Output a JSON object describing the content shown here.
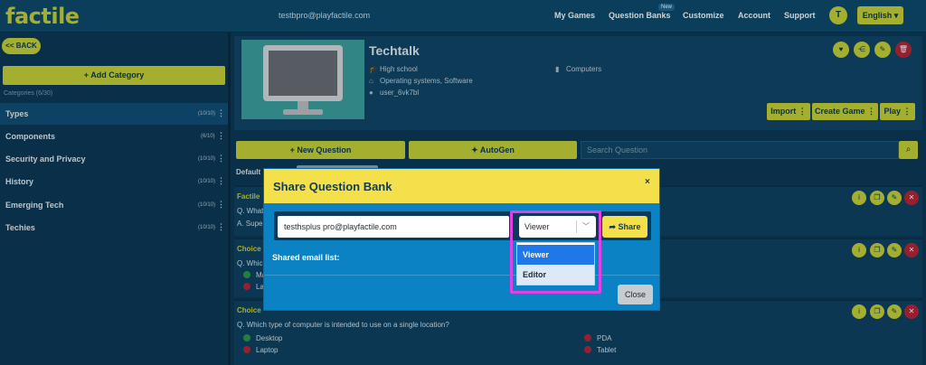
{
  "topbar": {
    "logo": "factile",
    "email": "testbpro@playfactile.com",
    "nav": [
      "My Games",
      "Question Banks",
      "Customize",
      "Account",
      "Support"
    ],
    "new_badge": "New",
    "avatar_letter": "T",
    "language": "English"
  },
  "sidebar": {
    "back_label": "<< BACK",
    "add_category_label": "Add Category",
    "categories_label": "Categories  (6/30)",
    "categories": [
      {
        "name": "Types",
        "count": "(10/10)"
      },
      {
        "name": "Components",
        "count": "(6/10)"
      },
      {
        "name": "Security and Privacy",
        "count": "(10/10)"
      },
      {
        "name": "History",
        "count": "(10/10)"
      },
      {
        "name": "Emerging Tech",
        "count": "(10/10)"
      },
      {
        "name": "Techies",
        "count": "(10/10)"
      }
    ]
  },
  "bank": {
    "title": "Techtalk",
    "grade": "High school",
    "tags": "Operating systems, Software",
    "owner": "user_6vk7bl",
    "subject": "Computers",
    "import_label": "Import",
    "create_game_label": "Create Game",
    "play_label": "Play"
  },
  "toolbar": {
    "new_question_label": "New Question",
    "autogen_label": "AutoGen",
    "search_placeholder": "Search Question",
    "default_label": "Default"
  },
  "questions": [
    {
      "type": "Factile",
      "text": "Q. What",
      "answer": "A. Super"
    },
    {
      "type": "Choice",
      "text": "Q. Which",
      "answers": [
        "Ma",
        "Lap"
      ]
    },
    {
      "type": "Choice",
      "text": "Q. Which type of computer is intended to use on a single location?",
      "answers": [
        "Desktop",
        "Laptop",
        "PDA",
        "Tablet"
      ]
    }
  ],
  "modal": {
    "title": "Share Question Bank",
    "close_x": "×",
    "email_value": "testhsplus pro@playfactile.com",
    "role_value": "Viewer",
    "share_label": "Share",
    "shared_list_label": "Shared email list:",
    "close_label": "Close",
    "role_options": [
      "Viewer",
      "Editor"
    ]
  },
  "colors": {
    "accent": "#c9d53a",
    "modal_header": "#f4e04a",
    "modal_body": "#0a82c4",
    "highlight": "#e040ea"
  }
}
